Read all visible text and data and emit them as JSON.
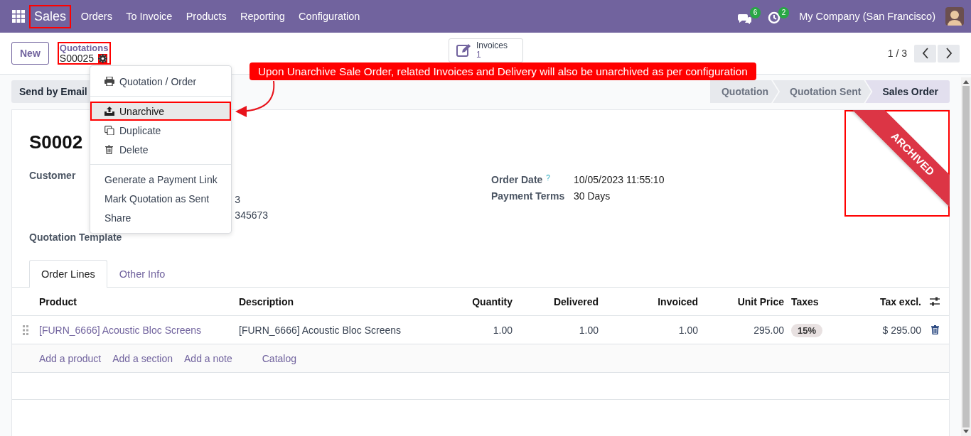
{
  "navbar": {
    "app": {
      "label": "Sales",
      "annotated": true
    },
    "menu": [
      "Orders",
      "To Invoice",
      "Products",
      "Reporting",
      "Configuration"
    ],
    "messages_badge": "6",
    "activities_badge": "2",
    "company": "My Company (San Francisco)"
  },
  "control_panel": {
    "new_button": "New",
    "breadcrumb": {
      "parent": "Quotations",
      "current": "S00025",
      "annotated": true
    },
    "gear_annotated": true,
    "smart_button": {
      "label": "Invoices",
      "count": "1"
    },
    "pager": "1 / 3"
  },
  "actions_menu": {
    "sections": [
      [
        {
          "label": "Quotation / Order",
          "kind": "print",
          "selected": false,
          "annotated": false
        }
      ],
      [
        {
          "label": "Unarchive",
          "kind": "upload",
          "selected": true,
          "annotated": true
        },
        {
          "label": "Duplicate",
          "kind": "copy",
          "selected": false,
          "annotated": false
        },
        {
          "label": "Delete",
          "kind": "trash",
          "selected": false,
          "annotated": false
        }
      ],
      [
        {
          "label": "Generate a Payment Link",
          "kind": "plain",
          "selected": false,
          "annotated": false
        },
        {
          "label": "Mark Quotation as Sent",
          "kind": "plain",
          "selected": false,
          "annotated": false
        },
        {
          "label": "Share",
          "kind": "plain",
          "selected": false,
          "annotated": false
        }
      ]
    ]
  },
  "callout": "Upon Unarchive Sale Order, related Invoices and Delivery will also be unarchived as per configuration",
  "status_bar": {
    "button": "Send by Email",
    "stages": [
      {
        "label": "Quotation",
        "selected": false
      },
      {
        "label": "Quotation Sent",
        "selected": false
      },
      {
        "label": "Sales Order",
        "selected": true
      }
    ]
  },
  "sheet": {
    "title": "S0002",
    "ribbon": {
      "label": "ARCHIVED",
      "annotated": true
    },
    "left_fields": [
      {
        "label": "Customer",
        "value_fragments": [
          "3",
          "345673"
        ]
      },
      {
        "label": "Quotation Template"
      }
    ],
    "right_fields": [
      {
        "label": "Order Date",
        "help": "?",
        "value": "10/05/2023 11:55:10"
      },
      {
        "label": "Payment Terms",
        "value": "30 Days"
      }
    ],
    "tabs": [
      {
        "label": "Order Lines",
        "selected": true
      },
      {
        "label": "Other Info",
        "selected": false
      }
    ],
    "table": {
      "columns": [
        "Product",
        "Description",
        "Quantity",
        "Delivered",
        "Invoiced",
        "Unit Price",
        "Taxes",
        "Tax excl."
      ],
      "rows": [
        {
          "cells": [
            {
              "text": "[FURN_6666] Acoustic Bloc Screens",
              "kind": "link"
            },
            {
              "text": "[FURN_6666] Acoustic Bloc Screens",
              "kind": "text"
            },
            {
              "text": "1.00",
              "kind": "text"
            },
            {
              "text": "1.00",
              "kind": "text"
            },
            {
              "text": "1.00",
              "kind": "text"
            },
            {
              "text": "295.00",
              "kind": "text"
            },
            {
              "text": "15%",
              "kind": "tag"
            },
            {
              "text": "$ 295.00",
              "kind": "text"
            }
          ]
        }
      ],
      "add_links": [
        "Add a product",
        "Add a section",
        "Add a note",
        "Catalog"
      ]
    }
  }
}
